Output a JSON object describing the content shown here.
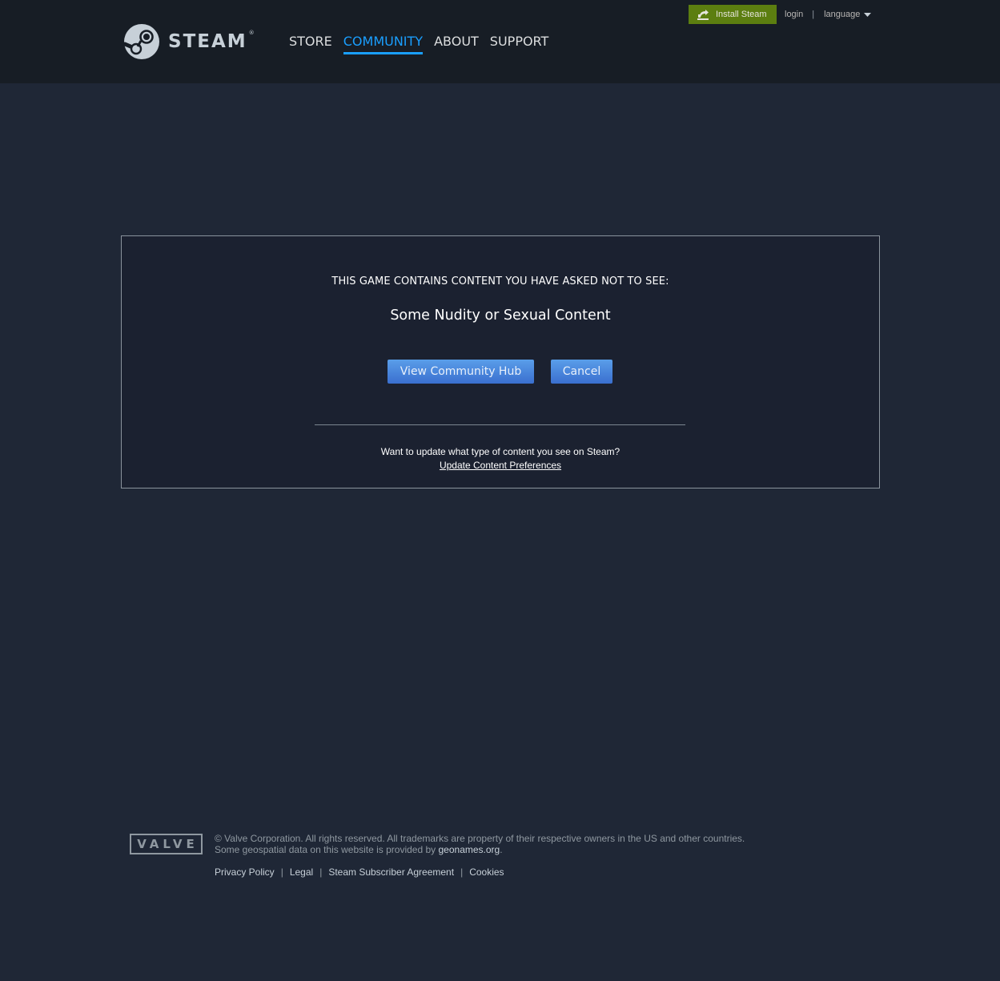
{
  "header": {
    "logo_text": "STEAM",
    "logo_reg": "®",
    "nav": [
      {
        "label": "STORE"
      },
      {
        "label": "COMMUNITY",
        "active": true
      },
      {
        "label": "ABOUT"
      },
      {
        "label": "SUPPORT"
      }
    ],
    "install_label": "Install Steam",
    "login_label": "login",
    "separator": "|",
    "language_label": "language"
  },
  "panel": {
    "heading": "THIS GAME CONTAINS CONTENT YOU HAVE ASKED NOT TO SEE:",
    "reason": "Some Nudity or Sexual Content",
    "view_hub_label": "View Community Hub",
    "cancel_label": "Cancel",
    "update_prompt": "Want to update what type of content you see on Steam?",
    "update_link": "Update Content Preferences"
  },
  "footer": {
    "valve_logo": "VALVE",
    "copyright": "© Valve Corporation. All rights reserved. All trademarks are property of their respective owners in the US and other countries.",
    "geo_prefix": "Some geospatial data on this website is provided by ",
    "geo_link": "geonames.org",
    "geo_suffix": ".",
    "links": [
      "Privacy Policy",
      "Legal",
      "Steam Subscriber Agreement",
      "Cookies"
    ],
    "link_separator": "|"
  },
  "colors": {
    "page_bg": "#1f2736",
    "header_bg": "#171d25",
    "nav_active": "#1a9fff",
    "install_bg": "#5c7e10",
    "button_blue": "#4d8ad9"
  }
}
